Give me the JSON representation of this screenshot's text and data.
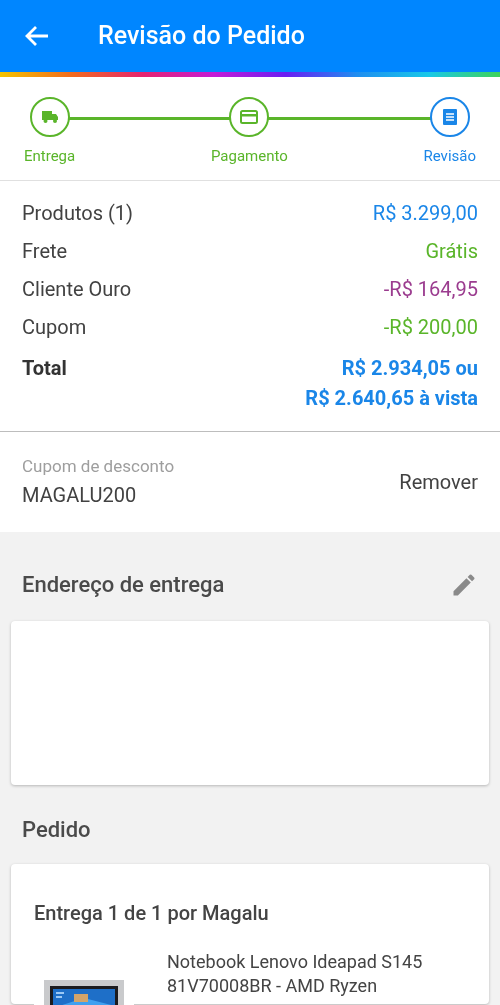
{
  "header": {
    "title": "Revisão do Pedido"
  },
  "steps": [
    {
      "label": "Entrega",
      "kind": "truck",
      "selected": false
    },
    {
      "label": "Pagamento",
      "kind": "card",
      "selected": false
    },
    {
      "label": "Revisão",
      "kind": "receipt",
      "selected": true
    }
  ],
  "summary": [
    {
      "label": "Produtos (1)",
      "value": "R$ 3.299,00",
      "color": "#1a86e8"
    },
    {
      "label": "Frete",
      "value": "Grátis",
      "color": "#5ab52a"
    },
    {
      "label": "Cliente Ouro",
      "value": "-R$ 164,95",
      "color": "#9b3c8f"
    },
    {
      "label": "Cupom",
      "value": "-R$ 200,00",
      "color": "#5ab52a"
    }
  ],
  "total": {
    "label": "Total",
    "lines": [
      "R$ 2.934,05 ou",
      "R$ 2.640,65 à vista"
    ]
  },
  "coupon": {
    "label": "Cupom de desconto",
    "code": "MAGALU200",
    "action": "Remover"
  },
  "address": {
    "title": "Endereço de entrega"
  },
  "order": {
    "title": "Pedido",
    "delivery": "Entrega 1 de 1 por Magalu",
    "product": {
      "kind": "picture",
      "name_lines": [
        "Notebook Lenovo Ideapad S145",
        "81V70008BR - AMD Ryzen"
      ]
    }
  }
}
